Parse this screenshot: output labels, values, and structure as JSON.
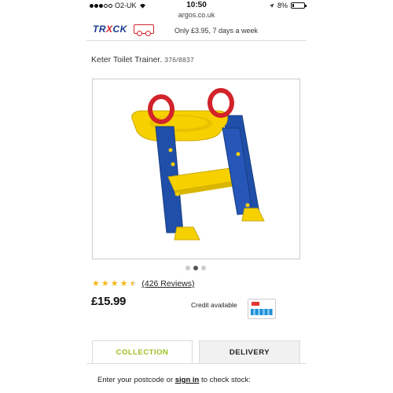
{
  "status_bar": {
    "carrier": "O2-UK",
    "time": "10:50",
    "battery": "8%"
  },
  "url": "argos.co.uk",
  "banner": {
    "logo_text_1": "TR",
    "logo_text_x": "X",
    "logo_text_2": "CK",
    "offer": "Only £3.95, 7 days a week"
  },
  "product": {
    "title": "Keter Toilet Trainer.",
    "code": "376/8837",
    "image_icon": "toilet-trainer-ladder-image",
    "carousel": {
      "count": 3,
      "active": 2
    },
    "rating": {
      "stars": 4.5,
      "reviews_label": "(426 Reviews)"
    },
    "price": "£15.99",
    "credit_label": "Credit available"
  },
  "tabs": [
    {
      "label": "COLLECTION",
      "active": true
    },
    {
      "label": "DELIVERY",
      "active": false
    }
  ],
  "stock": {
    "prefix": "Enter your postcode or ",
    "link": "sign in",
    "suffix": " to check stock:"
  },
  "colors": {
    "active_tab": "#9bbf1c",
    "star": "#f3b81a",
    "frame_blue": "#1f4fa8",
    "seat_yellow": "#f7d000",
    "handle_red": "#d2232a"
  }
}
